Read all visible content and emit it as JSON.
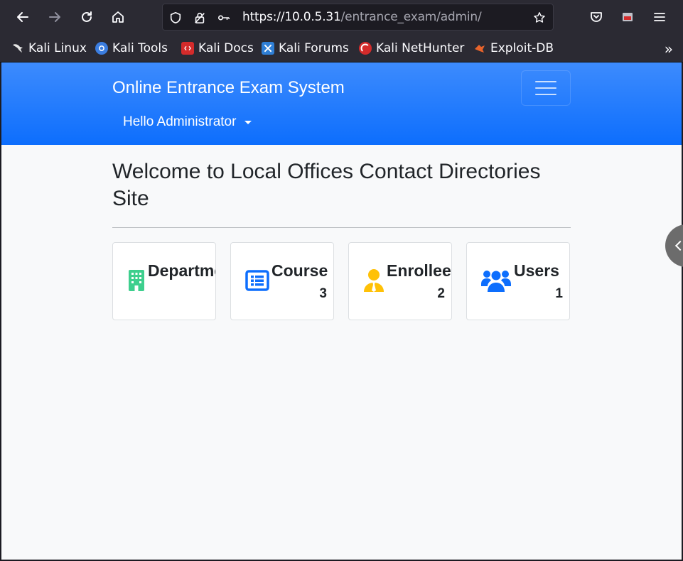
{
  "browser": {
    "url_host": "https://10.0.5.31",
    "url_path": "/entrance_exam/admin/",
    "bookmarks": [
      {
        "label": "Kali Linux",
        "icon": "kali-dragon-icon",
        "color": "#2b2a33"
      },
      {
        "label": "Kali Tools",
        "icon": "kali-tools-icon",
        "color": "#3b7de0"
      },
      {
        "label": "Kali Docs",
        "icon": "kali-docs-icon",
        "color": "#d42b2b"
      },
      {
        "label": "Kali Forums",
        "icon": "kali-forums-icon",
        "color": "#2f7fd6"
      },
      {
        "label": "Kali NetHunter",
        "icon": "kali-nethunter-icon",
        "color": "#d42b2b"
      },
      {
        "label": "Exploit-DB",
        "icon": "exploit-db-icon",
        "color": "#e8632b"
      }
    ]
  },
  "navbar": {
    "brand": "Online Entrance Exam System",
    "user_menu": "Hello Administrator"
  },
  "main": {
    "heading": "Welcome to Local Offices Contact Directories Site"
  },
  "cards": [
    {
      "title": "Departme",
      "count": "",
      "icon": "building-icon",
      "color": "#3ecf8e"
    },
    {
      "title": "Course",
      "count": "3",
      "icon": "list-icon",
      "color": "#0d6efd"
    },
    {
      "title": "Enrollees",
      "count": "2",
      "icon": "user-tie-icon",
      "color": "#ffc107"
    },
    {
      "title": "Users",
      "count": "1",
      "icon": "users-icon",
      "color": "#0d6efd"
    }
  ]
}
